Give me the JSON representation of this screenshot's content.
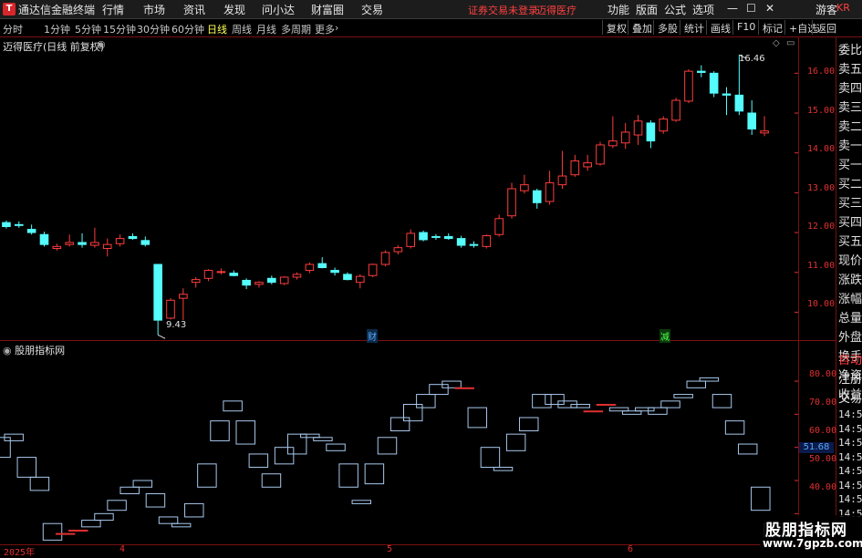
{
  "window": {
    "app_title": "通达信金融终端",
    "menus": [
      "行情",
      "市场",
      "资讯",
      "发现",
      "问小达",
      "财富圈",
      "交易"
    ],
    "warning": "证券交易未登录",
    "stock": "迈得医疗",
    "right_menus": [
      "功能",
      "版面",
      "公式",
      "选项"
    ],
    "guest": "游客"
  },
  "toolbar": {
    "periods": [
      "分时",
      "1分钟",
      "5分钟",
      "15分钟",
      "30分钟",
      "60分钟",
      "日线",
      "周线",
      "月线",
      "多周期",
      "更多"
    ],
    "active_period": "日线",
    "buttons": [
      "复权",
      "叠加",
      "多股",
      "统计",
      "画线",
      "F10",
      "标记",
      "+自选",
      "返回"
    ]
  },
  "main_chart": {
    "title": "迈得医疗(日线 前复权)",
    "y_ticks": [
      "16.00",
      "15.00",
      "14.00",
      "13.00",
      "12.00",
      "11.00",
      "10.00"
    ],
    "high_label": "16.46",
    "low_label": "9.43",
    "event_markers": [
      "财",
      "减"
    ]
  },
  "indicator": {
    "title": "股朋指标网",
    "y_ticks": [
      "80.00",
      "70.00",
      "60.00",
      "50.00",
      "40.00"
    ],
    "current_value": "51.68"
  },
  "x_axis": {
    "labels": [
      "2025年",
      "4",
      "5",
      "6"
    ]
  },
  "side_panel": {
    "labels": [
      "委比",
      "卖五",
      "卖四",
      "卖三",
      "卖二",
      "卖一",
      "买一",
      "买二",
      "买三",
      "买四",
      "买五",
      "现价",
      "涨跌",
      "涨幅",
      "总量",
      "外盘",
      "换手",
      "净资",
      "收益"
    ],
    "lower": [
      "自动",
      "注册",
      "交易"
    ],
    "time_rows": [
      "14:56",
      "14:56",
      "14:56",
      "14:56",
      "14:56",
      "14:56",
      "14:56",
      "14:56"
    ]
  },
  "watermark": {
    "title": "股朋指标网",
    "url": "www.7gpzb.com"
  },
  "chart_data": [
    {
      "type": "candlestick",
      "title": "迈得医疗(日线 前复权)",
      "ylim": [
        9.3,
        16.9
      ],
      "candles": [
        [
          12.25,
          12.3,
          12.1,
          12.15
        ],
        [
          12.2,
          12.28,
          12.12,
          12.18
        ],
        [
          12.08,
          12.2,
          11.95,
          12.0
        ],
        [
          11.95,
          12.02,
          11.65,
          11.7
        ],
        [
          11.6,
          11.72,
          11.55,
          11.65
        ],
        [
          11.7,
          11.95,
          11.65,
          11.75
        ],
        [
          11.75,
          11.98,
          11.62,
          11.7
        ],
        [
          11.68,
          12.12,
          11.62,
          11.75
        ],
        [
          11.6,
          11.85,
          11.4,
          11.7
        ],
        [
          11.72,
          11.95,
          11.65,
          11.85
        ],
        [
          11.9,
          11.98,
          11.82,
          11.85
        ],
        [
          11.8,
          11.9,
          11.65,
          11.7
        ],
        [
          11.2,
          11.2,
          9.43,
          9.8
        ],
        [
          9.85,
          10.35,
          9.82,
          10.3
        ],
        [
          10.35,
          10.6,
          9.8,
          10.45
        ],
        [
          10.75,
          10.88,
          10.62,
          10.82
        ],
        [
          10.85,
          11.08,
          10.78,
          11.05
        ],
        [
          11.0,
          11.1,
          10.95,
          11.02
        ],
        [
          10.98,
          11.05,
          10.9,
          10.92
        ],
        [
          10.8,
          10.85,
          10.58,
          10.68
        ],
        [
          10.7,
          10.78,
          10.62,
          10.75
        ],
        [
          10.85,
          10.92,
          10.7,
          10.75
        ],
        [
          10.72,
          10.9,
          10.68,
          10.88
        ],
        [
          10.88,
          11.0,
          10.82,
          10.95
        ],
        [
          11.05,
          11.25,
          10.98,
          11.2
        ],
        [
          11.22,
          11.38,
          11.1,
          11.12
        ],
        [
          11.05,
          11.12,
          10.92,
          11.0
        ],
        [
          10.95,
          11.0,
          10.8,
          10.82
        ],
        [
          10.75,
          10.95,
          10.6,
          10.9
        ],
        [
          10.92,
          11.22,
          10.88,
          11.2
        ],
        [
          11.2,
          11.55,
          11.15,
          11.5
        ],
        [
          11.52,
          11.68,
          11.45,
          11.62
        ],
        [
          11.65,
          12.08,
          11.6,
          11.98
        ],
        [
          12.0,
          12.05,
          11.78,
          11.82
        ],
        [
          11.9,
          11.96,
          11.82,
          11.88
        ],
        [
          11.9,
          11.98,
          11.82,
          11.85
        ],
        [
          11.85,
          11.92,
          11.62,
          11.68
        ],
        [
          11.7,
          11.78,
          11.62,
          11.68
        ],
        [
          11.65,
          11.95,
          11.6,
          11.92
        ],
        [
          11.95,
          12.45,
          11.9,
          12.35
        ],
        [
          12.42,
          13.25,
          12.35,
          13.1
        ],
        [
          13.05,
          13.45,
          12.98,
          13.2
        ],
        [
          13.05,
          13.1,
          12.6,
          12.75
        ],
        [
          12.78,
          13.55,
          12.7,
          13.25
        ],
        [
          13.2,
          14.05,
          13.1,
          13.42
        ],
        [
          13.45,
          13.95,
          13.4,
          13.8
        ],
        [
          13.65,
          13.95,
          13.55,
          13.75
        ],
        [
          13.72,
          14.28,
          13.68,
          14.2
        ],
        [
          14.18,
          14.92,
          14.12,
          14.3
        ],
        [
          14.25,
          14.75,
          14.1,
          14.52
        ],
        [
          14.45,
          14.95,
          14.2,
          14.8
        ],
        [
          14.75,
          14.82,
          14.12,
          14.3
        ],
        [
          14.55,
          14.92,
          14.48,
          14.85
        ],
        [
          14.82,
          15.38,
          14.78,
          15.32
        ],
        [
          15.3,
          16.1,
          15.25,
          16.05
        ],
        [
          16.05,
          16.2,
          15.9,
          16.02
        ],
        [
          16.0,
          16.05,
          15.4,
          15.5
        ],
        [
          15.48,
          15.65,
          14.95,
          15.45
        ],
        [
          15.45,
          16.46,
          14.95,
          15.05
        ],
        [
          15.0,
          15.32,
          14.45,
          14.6
        ],
        [
          14.5,
          14.92,
          14.42,
          14.55
        ]
      ]
    },
    {
      "type": "candlestick",
      "title": "股朋指标网",
      "ylim": [
        31,
        88
      ],
      "current_value": 51.68,
      "candles": [
        [
          63,
          63,
          57,
          57
        ],
        [
          64,
          64,
          62,
          62
        ],
        [
          57,
          57,
          51,
          51
        ],
        [
          51,
          51,
          47,
          47
        ],
        [
          37,
          37,
          32,
          32
        ],
        [
          34,
          34,
          34,
          34
        ],
        [
          35,
          35,
          35,
          35
        ],
        [
          38,
          38,
          36,
          36
        ],
        [
          40,
          40,
          38,
          38
        ],
        [
          44,
          44,
          41,
          41
        ],
        [
          48,
          48,
          46,
          46
        ],
        [
          50,
          50,
          48,
          48
        ],
        [
          46,
          46,
          42,
          42
        ],
        [
          39,
          39,
          37,
          37
        ],
        [
          37,
          37,
          36,
          36
        ],
        [
          43,
          43,
          39,
          39
        ],
        [
          55,
          55,
          48,
          48
        ],
        [
          68,
          68,
          62,
          62
        ],
        [
          74,
          74,
          71,
          71
        ],
        [
          68,
          68,
          61,
          61
        ],
        [
          58,
          58,
          54,
          54
        ],
        [
          52,
          52,
          48,
          48
        ],
        [
          60,
          60,
          55,
          55
        ],
        [
          64,
          64,
          58,
          58
        ],
        [
          64,
          64,
          63,
          63
        ],
        [
          63,
          63,
          62,
          62
        ],
        [
          61,
          61,
          59,
          59
        ],
        [
          55,
          55,
          48,
          48
        ],
        [
          44,
          44,
          43,
          43
        ],
        [
          55,
          55,
          49,
          49
        ],
        [
          63,
          63,
          58,
          58
        ],
        [
          69,
          69,
          65,
          65
        ],
        [
          73,
          73,
          68,
          68
        ],
        [
          76,
          76,
          72,
          72
        ],
        [
          79,
          79,
          76,
          76
        ],
        [
          80,
          80,
          78,
          78
        ],
        [
          78,
          78,
          78,
          78
        ],
        [
          72,
          72,
          66,
          66
        ],
        [
          60,
          60,
          54,
          54
        ],
        [
          54,
          54,
          53,
          53
        ],
        [
          64,
          64,
          59,
          59
        ],
        [
          69,
          69,
          65,
          65
        ],
        [
          76,
          76,
          72,
          72
        ],
        [
          76,
          76,
          73,
          73
        ],
        [
          74,
          74,
          72,
          72
        ],
        [
          73,
          73,
          72,
          72
        ],
        [
          71,
          71,
          71,
          71
        ],
        [
          73,
          73,
          73,
          73
        ],
        [
          72,
          72,
          71,
          71
        ],
        [
          71,
          71,
          70,
          70
        ],
        [
          72,
          72,
          71,
          71
        ],
        [
          72,
          72,
          70,
          70
        ],
        [
          74,
          74,
          72,
          72
        ],
        [
          76,
          76,
          75,
          75
        ],
        [
          80,
          80,
          78,
          78
        ],
        [
          81,
          81,
          80,
          80
        ],
        [
          76,
          76,
          72,
          72
        ],
        [
          68,
          68,
          64,
          64
        ],
        [
          61,
          61,
          58,
          58
        ],
        [
          48,
          48,
          41,
          41
        ],
        [
          37,
          37,
          33,
          33
        ]
      ]
    }
  ]
}
